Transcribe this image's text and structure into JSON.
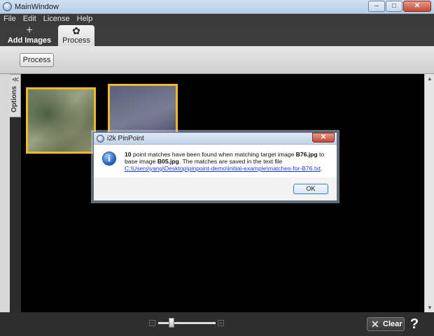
{
  "window": {
    "title": "MainWindow",
    "minimize": "–",
    "maximize": "□",
    "close": "✕"
  },
  "menu": [
    "File",
    "Edit",
    "License",
    "Help"
  ],
  "tabs": {
    "add_images": {
      "label": "Add Images",
      "icon": "plus-icon",
      "glyph": "+"
    },
    "process": {
      "label": "Process",
      "icon": "gear-icon",
      "glyph": "✿"
    }
  },
  "ribbon": {
    "process_button": "Process"
  },
  "side_panel": {
    "options_label": "Options",
    "collapse_glyph": "≪"
  },
  "images": [
    {
      "name": "image-B05"
    },
    {
      "name": "image-B76"
    }
  ],
  "dialog": {
    "title": "i2k PinPoint",
    "close": "✕",
    "info_glyph": "i",
    "message": {
      "count": "10",
      "part1": " point matches have been found when matching target image ",
      "target": "B76.jpg",
      "part2": " to base image ",
      "base": "B05.jpg",
      "part3": ". The matches are saved in the text file ",
      "file_link": "C:\\Users\\yang\\Desktop\\pinpoint-demo\\initial-example\\matches-for-B76.txt",
      "part4": "."
    },
    "ok_label": "OK"
  },
  "bottom_bar": {
    "zoom_minus": "−",
    "zoom_plus": "+",
    "zoom_level": 0.2,
    "clear_label": "Clear",
    "clear_glyph": "✕",
    "help_glyph": "?"
  },
  "colors": {
    "selection_border": "#f2b82d",
    "canvas": "#000000",
    "link": "#1a3ec9"
  }
}
